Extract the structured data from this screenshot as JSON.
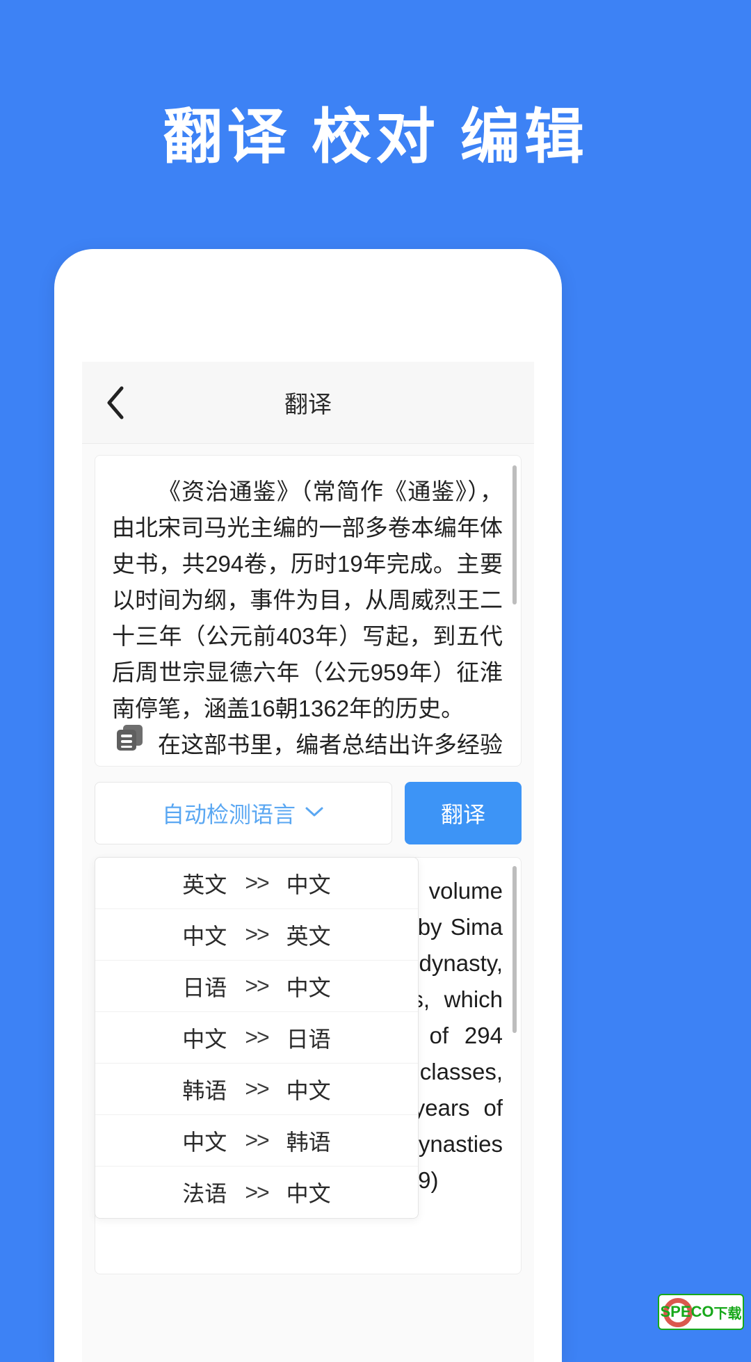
{
  "promo": {
    "headline": "翻译 校对 编辑"
  },
  "app": {
    "navbar": {
      "back_icon": "chevron-left-icon",
      "title": "翻译"
    },
    "source": {
      "paragraphs": [
        "《资治通鉴》（常简作《通鉴》），由北宋司马光主编的一部多卷本编年体史书，共294卷，历时19年完成。主要以时间为纲，事件为目，从周威烈王二十三年（公元前403年）写起，到五代后周世宗显德六年（公元959年）征淮南停笔，涵盖16朝1362年的历史。",
        "在这部书里，编者总结出许多经验教训，供"
      ],
      "copy_icon": "copy-document-icon"
    },
    "controls": {
      "lang_selector_label": "自动检测语言",
      "lang_selector_icon": "chevron-down-icon",
      "translate_button_label": "翻译"
    },
    "language_options": [
      {
        "from": "英文",
        "arrow": ">>",
        "to": "中文"
      },
      {
        "from": "中文",
        "arrow": ">>",
        "to": "英文"
      },
      {
        "from": "日语",
        "arrow": ">>",
        "to": "中文"
      },
      {
        "from": "中文",
        "arrow": ">>",
        "to": "日语"
      },
      {
        "from": "韩语",
        "arrow": ">>",
        "to": "中文"
      },
      {
        "from": "中文",
        "arrow": ">>",
        "to": "韩语"
      },
      {
        "from": "法语",
        "arrow": ">>",
        "to": "中文"
      }
    ],
    "result": {
      "text": "Zizhi Tongjian is a multi volume chronicle history book edited by Sima Guang in the northern song dynasty, with a total of 294 volumes, which took 19 years with a total of 294 volumes, in time, events as classes, to write from twenty three years of king Zhou Weilie, to the five dynasties erros of show on six years (959)"
    }
  },
  "watermark": {
    "brand": "SPECO",
    "suffix": "下载",
    "badge_color": "#17a81a",
    "ring_color": "#d33b2f"
  },
  "colors": {
    "background": "#3d82f5",
    "accent": "#3d94f6",
    "link": "#5aa7f2"
  }
}
